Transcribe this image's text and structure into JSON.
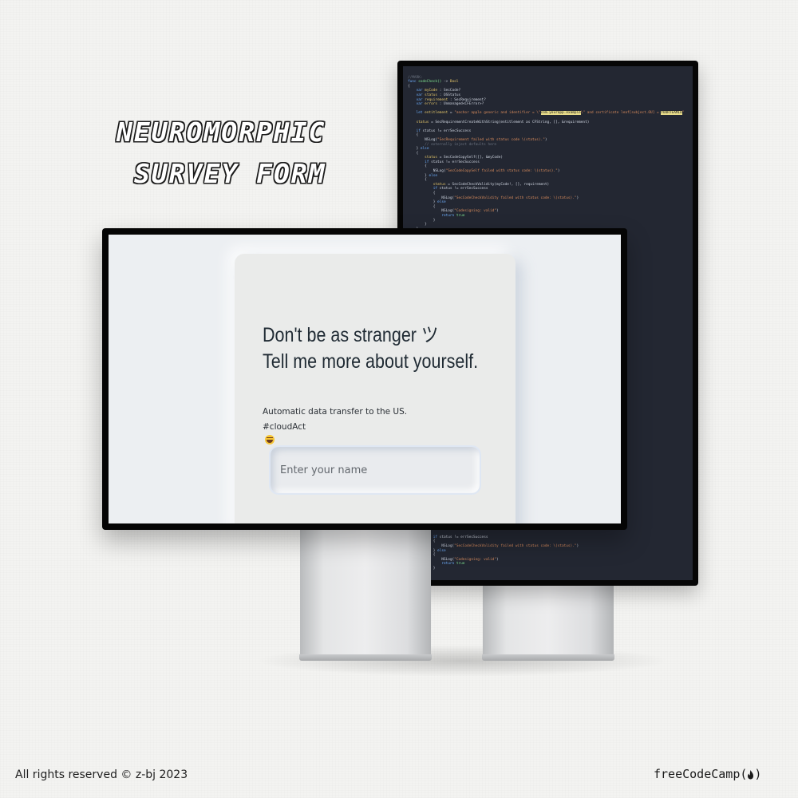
{
  "headline": {
    "line1": "NEUROMORPHIC",
    "line2": "SURVEY FORM"
  },
  "form": {
    "title_line1": "Don't be as stranger ツ",
    "title_line2": "Tell me more about yourself.",
    "subtitle_line1": "Automatic data transfer to the US.",
    "subtitle_line2": "#cloudAct",
    "name_placeholder": "Enter your name",
    "name_value": ""
  },
  "footer": {
    "copyright": "All rights reserved © z-bj 2023",
    "brand": "freeCodeCamp(",
    "brand_close": ")"
  },
  "colors": {
    "background": "#f3f3f1",
    "monitor_bezel": "#050505",
    "code_background": "#232732",
    "form_screen": "#eceff2",
    "card": "#eaebea",
    "title_text": "#1f2a33"
  },
  "icons": {
    "emoji": "grinning-sweat-emoji",
    "brand_logo": "flame-icon"
  }
}
